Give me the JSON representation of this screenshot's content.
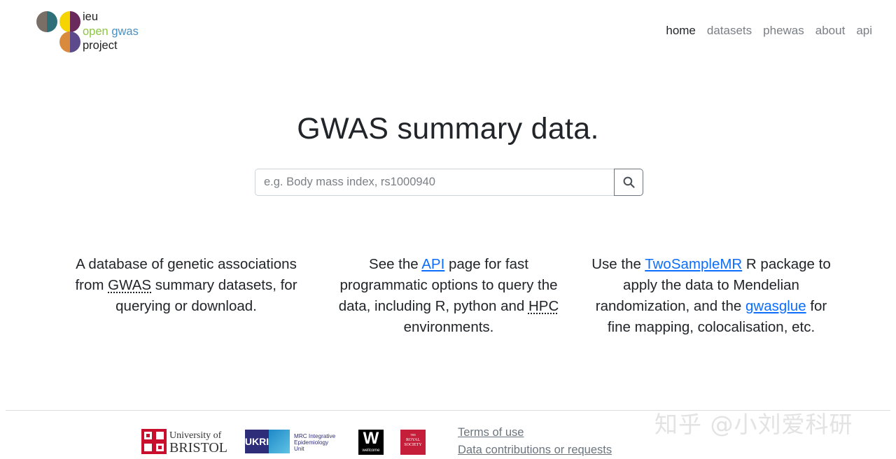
{
  "logo": {
    "line1": "ieu",
    "line2a": "open",
    "line2b": "gwas",
    "line3": "project",
    "colors": {
      "grey": "#7a6f66",
      "teal": "#2f6f78",
      "yellow": "#f5d400",
      "plum": "#6a2a5c",
      "orange": "#d98a3c",
      "violet": "#5b4a8c",
      "green": "#8dc63f",
      "blue": "#4a90c2"
    }
  },
  "nav": {
    "items": [
      {
        "label": "home",
        "active": true
      },
      {
        "label": "datasets",
        "active": false
      },
      {
        "label": "phewas",
        "active": false
      },
      {
        "label": "about",
        "active": false
      },
      {
        "label": "api",
        "active": false
      }
    ]
  },
  "hero": {
    "title": "GWAS summary data.",
    "search_placeholder": "e.g. Body mass index, rs1000940",
    "search_icon": "search-icon"
  },
  "columns": {
    "col1": {
      "pre": "A database of genetic associations from ",
      "abbr": "GWAS",
      "post": " summary datasets, for querying or download."
    },
    "col2": {
      "pre": "See the ",
      "link": "API",
      "mid": " page for fast programmatic options to query the data, including R, python and ",
      "abbr": "HPC",
      "post": " environments."
    },
    "col3": {
      "pre": "Use the ",
      "link1": "TwoSampleMR",
      "mid": " R package to apply the data to Mendelian randomization, and the ",
      "link2": "gwasglue",
      "post": " for fine mapping, colocalisation, etc."
    }
  },
  "footer": {
    "bristol": {
      "line1": "University of",
      "line2": "BRISTOL"
    },
    "ukri": {
      "mark": "UKRI",
      "line1": "MRC Integrative",
      "line2": "Epidemiology",
      "line3": "Unit"
    },
    "wellcome": {
      "mark": "W",
      "sub": "wellcome"
    },
    "royal": {
      "line1": "THE",
      "line2": "ROYAL",
      "line3": "SOCIETY"
    },
    "links": [
      "Terms of use",
      "Data contributions or requests"
    ]
  },
  "watermark": "知乎 @小刘爱科研"
}
